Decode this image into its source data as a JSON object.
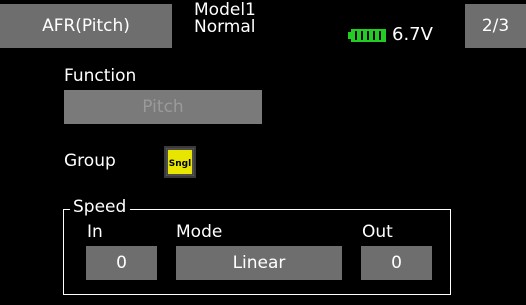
{
  "header": {
    "title": "AFR(Pitch)",
    "model_name": "Model1",
    "condition": "Normal",
    "voltage": "6.7V",
    "page": "2/3",
    "battery_color": "#22cc22"
  },
  "function": {
    "label": "Function",
    "value": "Pitch"
  },
  "group": {
    "label": "Group",
    "mode": "Sngl",
    "icon_color": "#e8e600"
  },
  "speed": {
    "title": "Speed",
    "in_label": "In",
    "in_value": "0",
    "mode_label": "Mode",
    "mode_value": "Linear",
    "out_label": "Out",
    "out_value": "0"
  }
}
